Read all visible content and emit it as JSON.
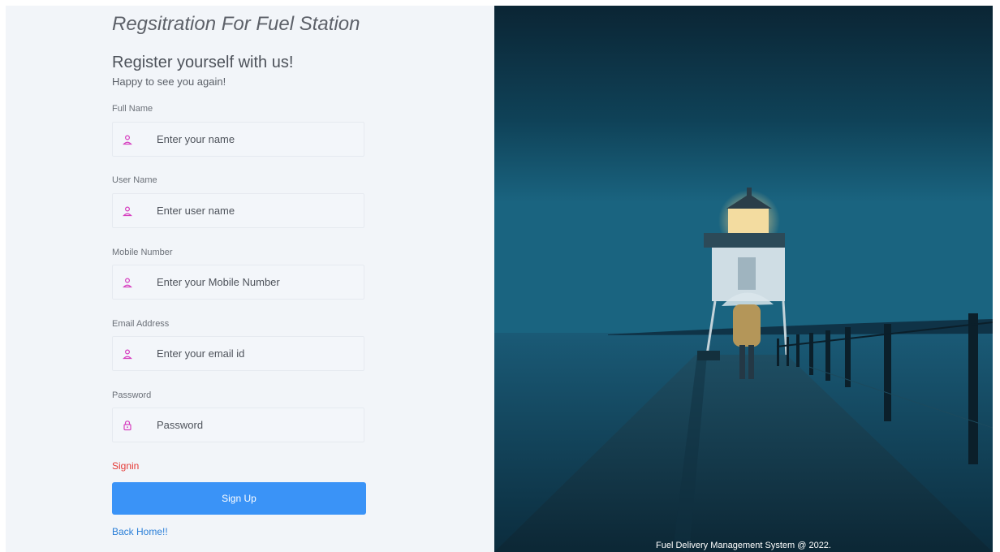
{
  "form": {
    "title": "Regsitration For Fuel Station",
    "heading": "Register yourself with us!",
    "subheading": "Happy to see you again!",
    "fields": [
      {
        "label": "Full Name",
        "placeholder": "Enter your name",
        "icon": "user-icon"
      },
      {
        "label": "User Name",
        "placeholder": "Enter user name",
        "icon": "user-icon"
      },
      {
        "label": "Mobile Number",
        "placeholder": "Enter your Mobile Number",
        "icon": "user-icon"
      },
      {
        "label": "Email Address",
        "placeholder": "Enter your email id",
        "icon": "user-icon"
      },
      {
        "label": "Password",
        "placeholder": "Password",
        "icon": "lock-icon"
      }
    ],
    "signin_label": "Signin",
    "signup_label": "Sign Up",
    "back_home_label": "Back Home!!"
  },
  "hero": {
    "footer": "Fuel Delivery Management System @ 2022."
  },
  "colors": {
    "accent": "#3a93f7",
    "signin": "#e53935",
    "icon": "#d63fbf",
    "panel_bg": "#f2f5f9"
  }
}
